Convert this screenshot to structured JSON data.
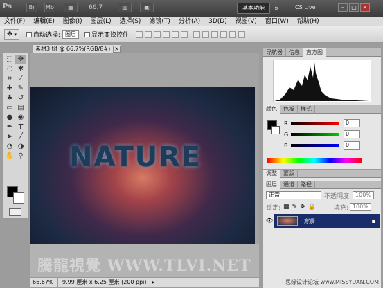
{
  "titlebar": {
    "app_logo": "Ps",
    "br_label": "Br",
    "mb_label": "Mb",
    "zoom": "66.7",
    "workspace_label": "基本功能",
    "more_label": "»",
    "cslive_label": "CS Live"
  },
  "menu": [
    "文件(F)",
    "编辑(E)",
    "图像(I)",
    "图层(L)",
    "选择(S)",
    "滤镜(T)",
    "分析(A)",
    "3D(D)",
    "视图(V)",
    "窗口(W)",
    "帮助(H)"
  ],
  "options": {
    "auto_select_label": "自动选择:",
    "auto_select_value": "图层",
    "show_transform_label": "显示变换控件"
  },
  "document": {
    "tab_title": "素材3.tif @ 66.7%(RGB/8#)",
    "artwork_text": "NATURE",
    "watermark": "騰龍視覺 WWW.TLVI.NET",
    "zoom_status": "66.67%",
    "size_status": "9.99 厘米 x 6.25 厘米 (200 ppi)"
  },
  "panels": {
    "nav_tabs": [
      "导航器",
      "信息",
      "直方图"
    ],
    "color_tabs": [
      "颜色",
      "色板",
      "样式"
    ],
    "adj_tabs": [
      "调整",
      "蒙版"
    ],
    "layer_tabs": [
      "图层",
      "通道",
      "路径"
    ],
    "rgb": [
      {
        "label": "R",
        "value": "0"
      },
      {
        "label": "G",
        "value": "0"
      },
      {
        "label": "B",
        "value": "0"
      }
    ],
    "blend_mode": "正常",
    "opacity_label": "不透明度:",
    "opacity_value": "100%",
    "lock_label": "锁定:",
    "fill_label": "填充:",
    "fill_value": "100%",
    "layer_name": "背景"
  },
  "footer_credit": "思缘设计论坛 www.MISSYUAN.COM",
  "colors": {
    "accent": "#1a2d6b",
    "red": "#c00000",
    "green": "#00a000",
    "blue": "#0000c0"
  }
}
